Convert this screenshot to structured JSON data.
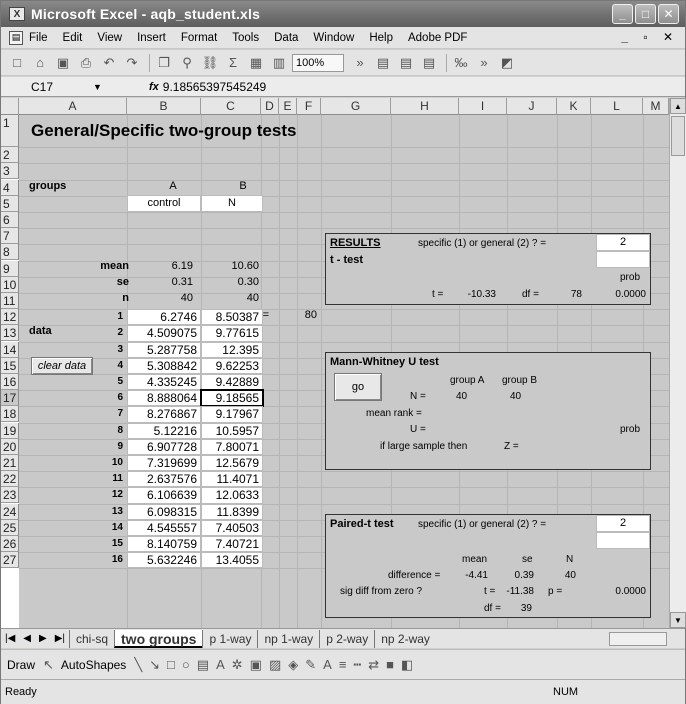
{
  "window": {
    "title": "Microsoft Excel - aqb_student.xls"
  },
  "menu": [
    "File",
    "Edit",
    "View",
    "Insert",
    "Format",
    "Tools",
    "Data",
    "Window",
    "Help",
    "Adobe PDF"
  ],
  "toolbar": {
    "zoom": "100%"
  },
  "formula_bar": {
    "name_box": "C17",
    "fx": "fx",
    "formula": "9.18565397545249"
  },
  "columns": [
    "A",
    "B",
    "C",
    "D",
    "E",
    "F",
    "G",
    "H",
    "I",
    "J",
    "K",
    "L",
    "M"
  ],
  "rows": [
    "1",
    "2",
    "3",
    "4",
    "5",
    "6",
    "7",
    "8",
    "9",
    "10",
    "11",
    "12",
    "13",
    "14",
    "15",
    "16",
    "17",
    "18",
    "19",
    "20",
    "21",
    "22",
    "23",
    "24",
    "25",
    "26",
    "27"
  ],
  "sheet": {
    "title": "General/Specific two-group tests",
    "groups_label": "groups",
    "group_a": "A",
    "group_b": "B",
    "group_a_name": "control",
    "group_b_name": "N",
    "mean_label": "mean",
    "se_label": "se",
    "n_label": "n",
    "mean_a": "6.19",
    "mean_b": "10.60",
    "se_a": "0.31",
    "se_b": "0.30",
    "n_a": "40",
    "n_b": "40",
    "total_n_label": "N =",
    "total_n": "80",
    "data_label": "data",
    "clear_data_button": "clear data",
    "data": [
      {
        "i": "1",
        "a": "6.2746",
        "b": "8.50387"
      },
      {
        "i": "2",
        "a": "4.509075",
        "b": "9.77615"
      },
      {
        "i": "3",
        "a": "5.287758",
        "b": "12.395"
      },
      {
        "i": "4",
        "a": "5.308842",
        "b": "9.62253"
      },
      {
        "i": "5",
        "a": "4.335245",
        "b": "9.42889"
      },
      {
        "i": "6",
        "a": "8.888064",
        "b": "9.18565"
      },
      {
        "i": "7",
        "a": "8.276867",
        "b": "9.17967"
      },
      {
        "i": "8",
        "a": "5.12216",
        "b": "10.5957"
      },
      {
        "i": "9",
        "a": "6.907728",
        "b": "7.80071"
      },
      {
        "i": "10",
        "a": "7.319699",
        "b": "12.5679"
      },
      {
        "i": "11",
        "a": "2.637576",
        "b": "11.4071"
      },
      {
        "i": "12",
        "a": "6.106639",
        "b": "12.0633"
      },
      {
        "i": "13",
        "a": "6.098315",
        "b": "11.8399"
      },
      {
        "i": "14",
        "a": "4.545557",
        "b": "7.40503"
      },
      {
        "i": "15",
        "a": "8.140759",
        "b": "7.40721"
      },
      {
        "i": "16",
        "a": "5.632246",
        "b": "13.4055"
      }
    ],
    "results": {
      "label": "RESULTS",
      "question": "specific (1) or general (2) ? =",
      "choice": "2",
      "ttest": "t - test",
      "prob_label": "prob",
      "t_label": "t =",
      "t_value": "-10.33",
      "df_label": "df =",
      "df_value": "78",
      "prob_value": "0.0000"
    },
    "mann_whitney": {
      "label": "Mann-Whitney U test",
      "go_button": "go",
      "group_a": "group A",
      "group_b": "group B",
      "n_label": "N =",
      "n_a": "40",
      "n_b": "40",
      "mean_rank": "mean rank =",
      "u_label": "U =",
      "prob_label": "prob",
      "large_sample": "if large sample then",
      "z_label": "Z ="
    },
    "paired": {
      "label": "Paired-t test",
      "question": "specific (1) or general (2) ? =",
      "choice": "2",
      "mean_h": "mean",
      "se_h": "se",
      "n_h": "N",
      "difference": "difference =",
      "diff_mean": "-4.41",
      "diff_se": "0.39",
      "diff_n": "40",
      "sig_label": "sig diff from zero ?",
      "t_label": "t =",
      "t_value": "-11.38",
      "p_label": "p =",
      "p_value": "0.0000",
      "df_label": "df =",
      "df_value": "39"
    }
  },
  "tabs": [
    "chi-sq",
    "two groups",
    "p 1-way",
    "np 1-way",
    "p 2-way",
    "np 2-way"
  ],
  "drawbar": {
    "draw": "Draw",
    "autoshapes": "AutoShapes"
  },
  "status": {
    "ready": "Ready",
    "num": "NUM"
  }
}
